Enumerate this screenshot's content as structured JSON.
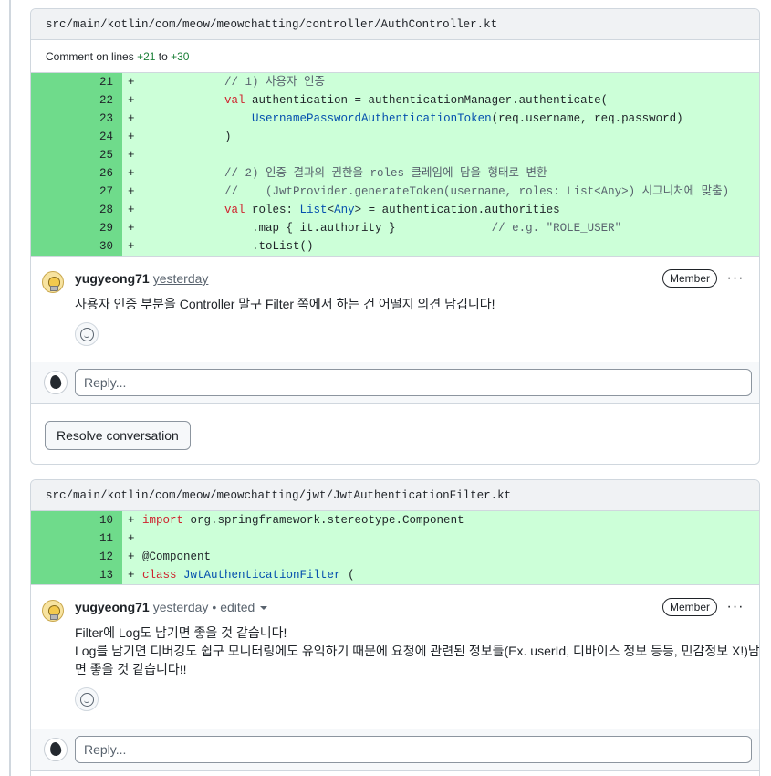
{
  "threads": [
    {
      "file_path": "src/main/kotlin/com/meow/meowchatting/controller/AuthController.kt",
      "comment_on": {
        "prefix": "Comment on lines",
        "start": "+21",
        "joiner": "to",
        "end": "+30"
      },
      "comment": {
        "author": "yugyeong71",
        "time": "yesterday",
        "badge": "Member",
        "body": [
          "사용자 인증 부분을 Controller 말구 Filter 쪽에서 하는 건 어떨지 의견 남깁니다!"
        ]
      },
      "reply_placeholder": "Reply...",
      "resolve_label": "Resolve conversation"
    },
    {
      "file_path": "src/main/kotlin/com/meow/meowchatting/jwt/JwtAuthenticationFilter.kt",
      "comment": {
        "author": "yugyeong71",
        "time": "yesterday",
        "edited": "• edited",
        "badge": "Member",
        "body": [
          "Filter에 Log도 남기면 좋을 것 같습니다!",
          "Log를 남기면 디버깅도 쉽구 모니터링에도 유익하기 때문에 요청에 관련된 정보들(Ex. userId, 디바이스 정보 등등, 민감정보 X!)남기",
          "면 좋을 것 같습니다!!"
        ]
      },
      "reply_placeholder": "Reply..."
    }
  ],
  "diff1": [
    {
      "num": "21",
      "sign": "+",
      "segs": [
        [
          "",
          "            "
        ],
        [
          "cm",
          "// 1) 사용자 인증"
        ]
      ]
    },
    {
      "num": "22",
      "sign": "+",
      "segs": [
        [
          "",
          "            "
        ],
        [
          "kw",
          "val"
        ],
        [
          "",
          " authentication = authenticationManager.authenticate("
        ]
      ]
    },
    {
      "num": "23",
      "sign": "+",
      "segs": [
        [
          "",
          "                "
        ],
        [
          "ty",
          "UsernamePasswordAuthenticationToken"
        ],
        [
          "",
          "(req.username, req.password)"
        ]
      ]
    },
    {
      "num": "24",
      "sign": "+",
      "segs": [
        [
          "",
          "            )"
        ]
      ]
    },
    {
      "num": "25",
      "sign": "+",
      "segs": [
        [
          "",
          ""
        ]
      ]
    },
    {
      "num": "26",
      "sign": "+",
      "segs": [
        [
          "",
          "            "
        ],
        [
          "cm",
          "// 2) 인증 결과의 권한을 roles 클레임에 담을 형태로 변환"
        ]
      ]
    },
    {
      "num": "27",
      "sign": "+",
      "segs": [
        [
          "",
          "            "
        ],
        [
          "cm",
          "//    (JwtProvider.generateToken(username, roles: List<Any>) 시그니처에 맞춤)"
        ]
      ]
    },
    {
      "num": "28",
      "sign": "+",
      "segs": [
        [
          "",
          "            "
        ],
        [
          "kw",
          "val"
        ],
        [
          "",
          " roles: "
        ],
        [
          "ty",
          "List"
        ],
        [
          "",
          "<"
        ],
        [
          "ty",
          "Any"
        ],
        [
          "",
          "> = authentication.authorities"
        ]
      ]
    },
    {
      "num": "29",
      "sign": "+",
      "segs": [
        [
          "",
          "                .map { it.authority }              "
        ],
        [
          "cm",
          "// e.g. \"ROLE_USER\""
        ]
      ]
    },
    {
      "num": "30",
      "sign": "+",
      "segs": [
        [
          "",
          "                .toList()"
        ]
      ]
    }
  ],
  "diff2": [
    {
      "num": "10",
      "sign": "+",
      "segs": [
        [
          "kw",
          "import"
        ],
        [
          "",
          " org.springframework.stereotype.Component"
        ]
      ]
    },
    {
      "num": "11",
      "sign": "+",
      "segs": [
        [
          "",
          ""
        ]
      ]
    },
    {
      "num": "12",
      "sign": "+",
      "segs": [
        [
          "",
          "@Component"
        ]
      ]
    },
    {
      "num": "13",
      "sign": "+",
      "segs": [
        [
          "kw",
          "class"
        ],
        [
          "",
          " "
        ],
        [
          "ty",
          "JwtAuthenticationFilter"
        ],
        [
          "",
          " ("
        ]
      ]
    }
  ],
  "colors": {
    "added_bg": "#ccffd8",
    "added_num_bg": "#6fdb8b",
    "keyword": "#cf222e",
    "comment": "#59636e",
    "type": "#0550ae"
  },
  "icons": [
    "smiley-icon",
    "kebab-horizontal-icon",
    "avatar-icon",
    "caret-down-icon"
  ]
}
